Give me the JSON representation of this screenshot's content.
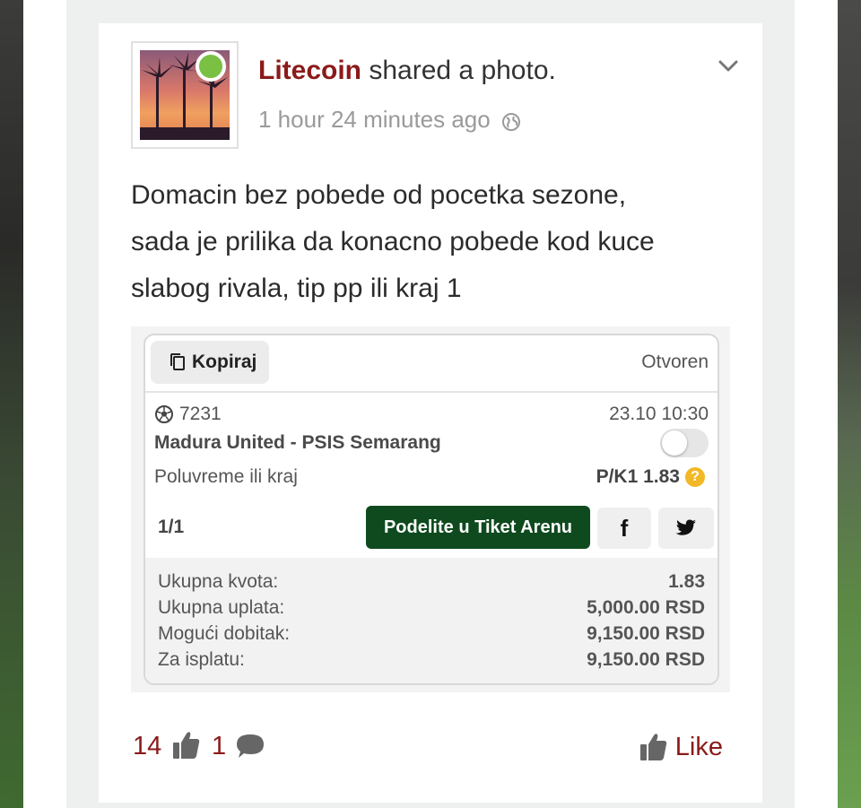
{
  "post": {
    "author": "Litecoin",
    "action": "shared a photo.",
    "time": "1 hour 24 minutes ago",
    "text_lines": [
      "Domacin bez pobede od pocetka sezone,",
      "sada je prilika da konacno pobede kod kuce",
      "slabog rivala, tip pp ili kraj 1"
    ]
  },
  "ticket": {
    "copy_label": "Kopiraj",
    "status": "Otvoren",
    "event_code": "7231",
    "event_datetime": "23.10 10:30",
    "match": "Madura United - PSIS Semarang",
    "market": "Poluvreme ili kraj",
    "pick": "P/K1 1.83",
    "count": "1/1",
    "share_label": "Podelite u Tiket Arenu",
    "facebook_label": "f",
    "summary": [
      {
        "label": "Ukupna kvota:",
        "value": "1.83"
      },
      {
        "label": "Ukupna uplata:",
        "value": "5,000.00 RSD"
      },
      {
        "label": "Mogući dobitak:",
        "value": "9,150.00 RSD"
      },
      {
        "label": "Za isplatu:",
        "value": "9,150.00 RSD"
      }
    ]
  },
  "footer": {
    "likes": "14",
    "comments": "1",
    "like_label": "Like"
  },
  "colors": {
    "brand": "#8b1a1a",
    "online": "#79c043",
    "share_button": "#0e4a1e",
    "help_badge": "#f2b826"
  },
  "icons": [
    "globe-icon",
    "chevron-down-icon",
    "copy-icon",
    "soccer-ball-icon",
    "help-icon",
    "facebook-icon",
    "twitter-icon",
    "thumbs-up-icon",
    "comment-icon"
  ]
}
